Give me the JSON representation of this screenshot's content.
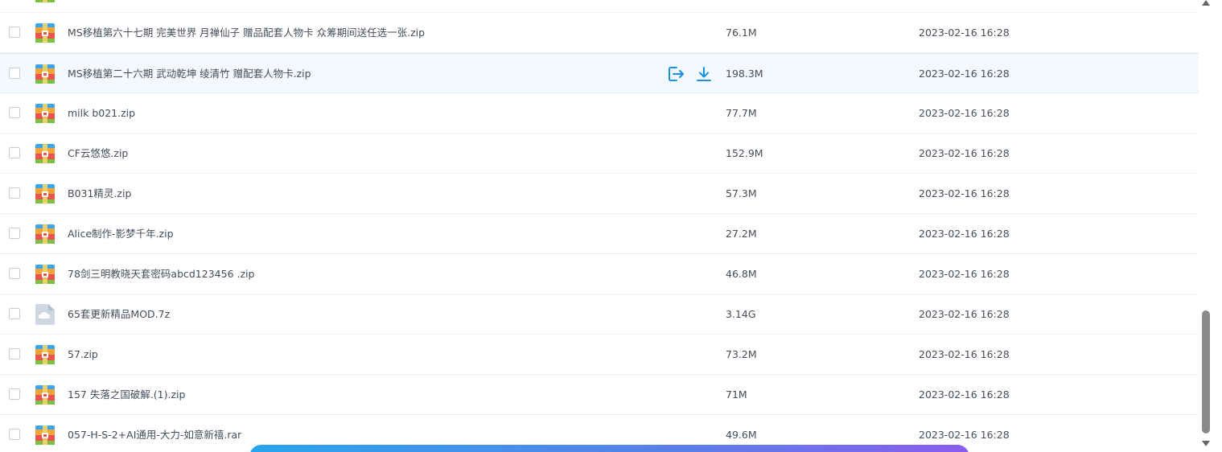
{
  "files": [
    {
      "name": "",
      "size": "",
      "date": "",
      "type": "zip"
    },
    {
      "name": "MS移植第六十七期 完美世界 月禅仙子 赠品配套人物卡 众筹期间送任选一张.zip",
      "size": "76.1M",
      "date": "2023-02-16 16:28",
      "type": "zip"
    },
    {
      "name": "MS移植第二十六期 武动乾坤 绫清竹 赠配套人物卡.zip",
      "size": "198.3M",
      "date": "2023-02-16 16:28",
      "type": "zip"
    },
    {
      "name": "milk b021.zip",
      "size": "77.7M",
      "date": "2023-02-16 16:28",
      "type": "zip"
    },
    {
      "name": "CF云悠悠.zip",
      "size": "152.9M",
      "date": "2023-02-16 16:28",
      "type": "zip"
    },
    {
      "name": "B031精灵.zip",
      "size": "57.3M",
      "date": "2023-02-16 16:28",
      "type": "zip"
    },
    {
      "name": "Alice制作-影梦千年.zip",
      "size": "27.2M",
      "date": "2023-02-16 16:28",
      "type": "zip"
    },
    {
      "name": "78剑三明教晓天套密码abcd123456 .zip",
      "size": "46.8M",
      "date": "2023-02-16 16:28",
      "type": "zip"
    },
    {
      "name": "65套更新精品MOD.7z",
      "size": "3.14G",
      "date": "2023-02-16 16:28",
      "type": "cloud"
    },
    {
      "name": "57.zip",
      "size": "73.2M",
      "date": "2023-02-16 16:28",
      "type": "zip"
    },
    {
      "name": "157 失落之国破解.(1).zip",
      "size": "71M",
      "date": "2023-02-16 16:28",
      "type": "zip"
    },
    {
      "name": "057-H-S-2+AI通用-大力-如意新禧.rar",
      "size": "49.6M",
      "date": "2023-02-16 16:28",
      "type": "zip"
    }
  ],
  "hover_index": 2,
  "icons": {
    "share": "share-export-icon",
    "download": "download-icon"
  },
  "colors": {
    "accent": "#1a8fe8",
    "text": "#454d5a",
    "hover_bg": "#f4f9ff",
    "divider": "#eef0f4"
  }
}
